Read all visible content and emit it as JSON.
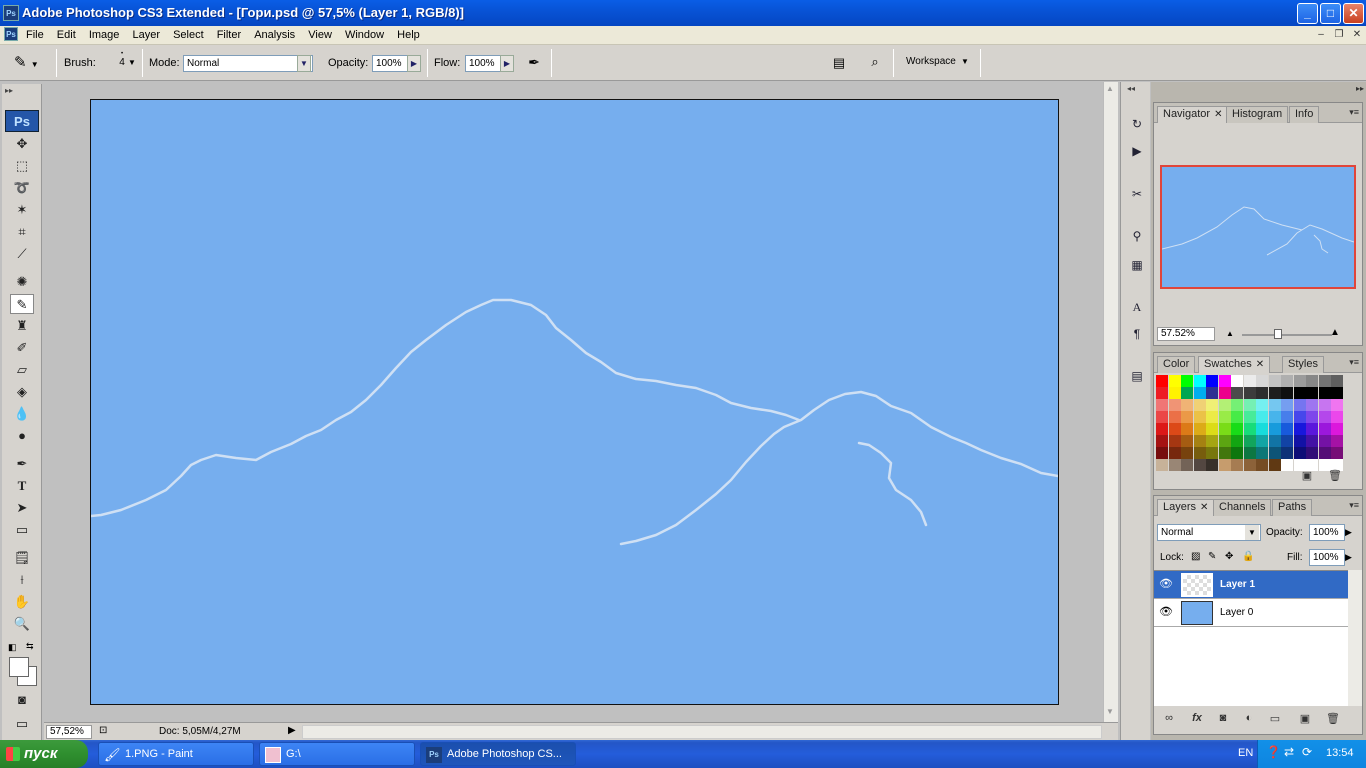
{
  "window": {
    "title": "Adobe Photoshop CS3 Extended - [Гори.psd @ 57,5% (Layer 1, RGB/8)]",
    "app_icon": "Ps",
    "controls": {
      "minimize": "_",
      "maximize": "□",
      "close": "✕"
    }
  },
  "menu": {
    "items": [
      "File",
      "Edit",
      "Image",
      "Layer",
      "Select",
      "Filter",
      "Analysis",
      "View",
      "Window",
      "Help"
    ]
  },
  "options_bar": {
    "brush_label": "Brush:",
    "brush_size": "4",
    "mode_label": "Mode:",
    "mode_value": "Normal",
    "opacity_label": "Opacity:",
    "opacity_value": "100%",
    "flow_label": "Flow:",
    "flow_value": "100%",
    "workspace_label": "Workspace"
  },
  "toolbox": {
    "logo": "Ps",
    "tools": [
      "move-tool",
      "marquee-tool",
      "lasso-tool",
      "magic-wand-tool",
      "crop-tool",
      "eyedropper-tool",
      "healing-brush-tool",
      "brush-tool",
      "clone-stamp-tool",
      "history-brush-tool",
      "eraser-tool",
      "paint-bucket-tool",
      "blur-tool",
      "dodge-tool",
      "pen-tool",
      "type-tool",
      "path-selection-tool",
      "shape-tool",
      "notes-tool",
      "eyedropper2-tool",
      "hand-tool",
      "zoom-tool"
    ],
    "selected_tool": "brush-tool"
  },
  "status": {
    "zoom": "57,52%",
    "doc_info": "Doc: 5,05M/4,27M"
  },
  "navigator": {
    "tabs": [
      "Navigator",
      "Histogram",
      "Info"
    ],
    "zoom": "57.52%"
  },
  "swatches_panel": {
    "tabs": [
      "Color",
      "Swatches",
      "Styles"
    ]
  },
  "layers_panel": {
    "tabs": [
      "Layers",
      "Channels",
      "Paths"
    ],
    "blend_mode": "Normal",
    "opacity_label": "Opacity:",
    "opacity_value": "100%",
    "lock_label": "Lock:",
    "fill_label": "Fill:",
    "fill_value": "100%",
    "layers": [
      {
        "name": "Layer 1",
        "selected": true
      },
      {
        "name": "Layer 0",
        "selected": false
      }
    ]
  },
  "taskbar": {
    "start": "пуск",
    "buttons": [
      {
        "label": "1.PNG - Paint",
        "active": false
      },
      {
        "label": "G:\\",
        "active": false
      },
      {
        "label": "Adobe Photoshop CS...",
        "active": true
      }
    ],
    "lang": "EN",
    "time": "13:54"
  },
  "colors": {
    "canvas": "#76aeee",
    "stroke": "#cfe0f4",
    "selected_layer": "#316ac5",
    "nav_frame": "#e0453a"
  }
}
